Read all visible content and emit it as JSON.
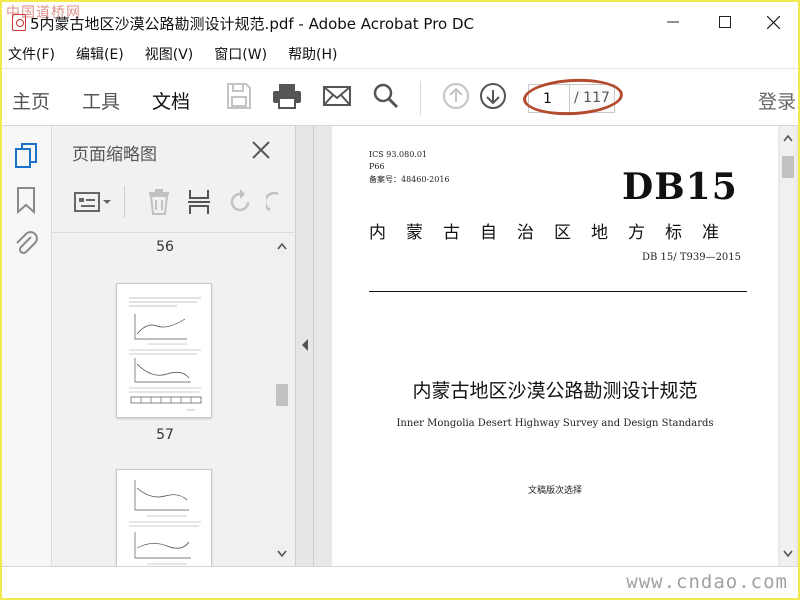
{
  "window": {
    "title": "5内蒙古地区沙漠公路勘测设计规范.pdf - Adobe Acrobat Pro DC",
    "watermark_top": "中国道桥网"
  },
  "menu": [
    "文件(F)",
    "编辑(E)",
    "视图(V)",
    "窗口(W)",
    "帮助(H)"
  ],
  "toolbar": {
    "tabs": [
      "主页",
      "工具",
      "文档"
    ],
    "active_tab": "文档",
    "page_current": "1",
    "page_total": "/ 117",
    "login": "登录",
    "annotation_color": "#b44a2e"
  },
  "panel": {
    "title": "页面缩略图",
    "thumb_labels": [
      "56",
      "57"
    ]
  },
  "document": {
    "ics": "ICS 93.080.01",
    "p_code": "P66",
    "record_no": "备案号：48460-2016",
    "code": "DB15",
    "standard_type": "内蒙古自治区地方标准",
    "std_number": "DB 15/ T939—2015",
    "title_cn": "内蒙古地区沙漠公路勘测设计规范",
    "title_en": "Inner Mongolia Desert Highway Survey and Design Standards",
    "edition": "文稿版次选择"
  },
  "footer": {
    "watermark": "www.cndao.com"
  }
}
